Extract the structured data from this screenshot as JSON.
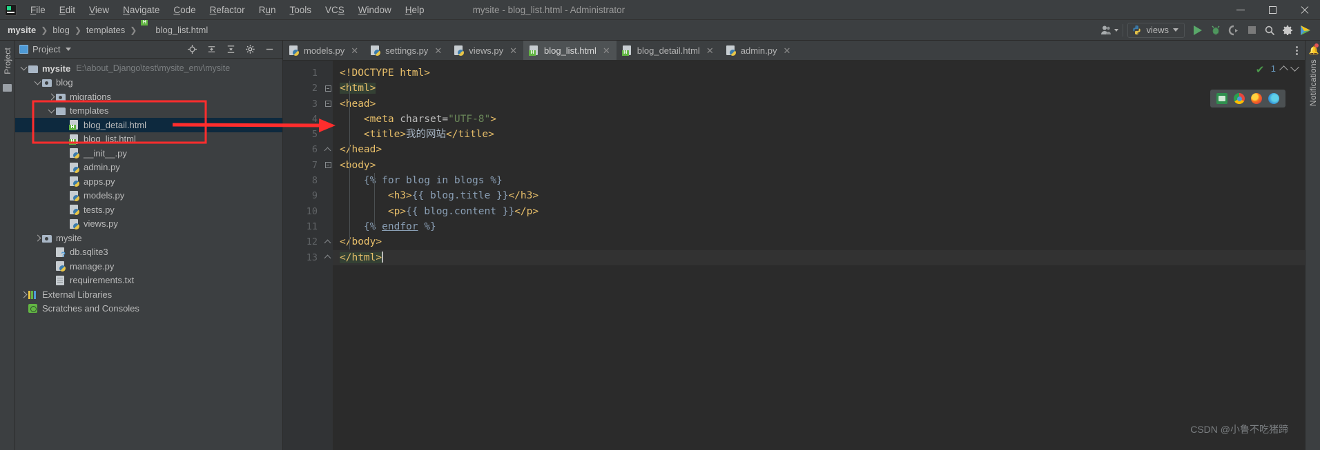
{
  "window": {
    "title": "mysite - blog_list.html - Administrator",
    "app_icon": "pycharm-logo-icon",
    "minimize": "—",
    "maximize": "□",
    "close": "✕"
  },
  "menu": {
    "items": [
      {
        "label": "File",
        "mnemonic": "F"
      },
      {
        "label": "Edit",
        "mnemonic": "E"
      },
      {
        "label": "View",
        "mnemonic": "V"
      },
      {
        "label": "Navigate",
        "mnemonic": "N"
      },
      {
        "label": "Code",
        "mnemonic": "C"
      },
      {
        "label": "Refactor",
        "mnemonic": "R"
      },
      {
        "label": "Run",
        "mnemonic": "u"
      },
      {
        "label": "Tools",
        "mnemonic": "T"
      },
      {
        "label": "VCS",
        "mnemonic": "S"
      },
      {
        "label": "Window",
        "mnemonic": "W"
      },
      {
        "label": "Help",
        "mnemonic": "H"
      }
    ]
  },
  "breadcrumb": {
    "separator": "›",
    "items": [
      {
        "label": "mysite",
        "bold": true,
        "icon": null
      },
      {
        "label": "blog",
        "bold": false,
        "icon": null
      },
      {
        "label": "templates",
        "bold": false,
        "icon": null
      },
      {
        "label": "blog_list.html",
        "bold": false,
        "icon": "html-file-icon"
      }
    ]
  },
  "toolbar": {
    "account_icon": "user-account-icon",
    "run_config": {
      "label": "views",
      "icon": "python-icon",
      "dropdown_icon": "chevron-down-icon"
    },
    "run_icon": "run-play-icon",
    "debug_icon": "debug-bug-icon",
    "coverage_icon": "run-coverage-icon",
    "stop_icon": "stop-square-icon",
    "search_icon": "search-magnifier-icon",
    "settings_icon": "gear-icon",
    "updates_icon": "jetbrains-toolbox-icon"
  },
  "project_panel": {
    "title": "Project",
    "title_icon": "project-view-icon",
    "dropdown_icon": "chevron-down-icon",
    "header_icons": [
      "target-locate-icon",
      "expand-all-icon",
      "collapse-all-icon",
      "gear-icon",
      "hide-panel-icon"
    ],
    "vertical_label": "Project",
    "tree": [
      {
        "label": "mysite",
        "path": "E:\\about_Django\\test\\mysite_env\\mysite",
        "icon": "folder-icon",
        "indent": 0,
        "arrow": "down",
        "bold": true,
        "selected": false
      },
      {
        "label": "blog",
        "path": "",
        "icon": "module-folder-icon",
        "indent": 1,
        "arrow": "down",
        "bold": false,
        "selected": false
      },
      {
        "label": "migrations",
        "path": "",
        "icon": "module-folder-icon",
        "indent": 2,
        "arrow": "right",
        "bold": false,
        "selected": false
      },
      {
        "label": "templates",
        "path": "",
        "icon": "folder-icon",
        "indent": 2,
        "arrow": "down",
        "bold": false,
        "selected": false
      },
      {
        "label": "blog_detail.html",
        "path": "",
        "icon": "html-file-icon",
        "indent": 3,
        "arrow": "none",
        "bold": false,
        "selected": true
      },
      {
        "label": "blog_list.html",
        "path": "",
        "icon": "html-file-icon",
        "indent": 3,
        "arrow": "none",
        "bold": false,
        "selected": false
      },
      {
        "label": "__init__.py",
        "path": "",
        "icon": "python-file-icon",
        "indent": 3,
        "arrow": "none",
        "bold": false,
        "selected": false
      },
      {
        "label": "admin.py",
        "path": "",
        "icon": "python-file-icon",
        "indent": 3,
        "arrow": "none",
        "bold": false,
        "selected": false
      },
      {
        "label": "apps.py",
        "path": "",
        "icon": "python-file-icon",
        "indent": 3,
        "arrow": "none",
        "bold": false,
        "selected": false
      },
      {
        "label": "models.py",
        "path": "",
        "icon": "python-file-icon",
        "indent": 3,
        "arrow": "none",
        "bold": false,
        "selected": false
      },
      {
        "label": "tests.py",
        "path": "",
        "icon": "python-file-icon",
        "indent": 3,
        "arrow": "none",
        "bold": false,
        "selected": false
      },
      {
        "label": "views.py",
        "path": "",
        "icon": "python-file-icon",
        "indent": 3,
        "arrow": "none",
        "bold": false,
        "selected": false
      },
      {
        "label": "mysite",
        "path": "",
        "icon": "module-folder-icon",
        "indent": 1,
        "arrow": "right",
        "bold": false,
        "selected": false
      },
      {
        "label": "db.sqlite3",
        "path": "",
        "icon": "database-file-icon",
        "indent": 2,
        "arrow": "none",
        "bold": false,
        "selected": false
      },
      {
        "label": "manage.py",
        "path": "",
        "icon": "python-file-icon",
        "indent": 2,
        "arrow": "none",
        "bold": false,
        "selected": false
      },
      {
        "label": "requirements.txt",
        "path": "",
        "icon": "text-file-icon",
        "indent": 2,
        "arrow": "none",
        "bold": false,
        "selected": false
      },
      {
        "label": "External Libraries",
        "path": "",
        "icon": "libraries-icon",
        "indent": 0,
        "arrow": "right",
        "bold": false,
        "selected": false
      },
      {
        "label": "Scratches and Consoles",
        "path": "",
        "icon": "scratches-icon",
        "indent": 0,
        "arrow": "none",
        "bold": false,
        "selected": false
      }
    ]
  },
  "editor": {
    "tabs": [
      {
        "label": "models.py",
        "icon": "python-file-icon",
        "active": false,
        "close_icon": "close-icon"
      },
      {
        "label": "settings.py",
        "icon": "python-file-icon",
        "active": false,
        "close_icon": "close-icon"
      },
      {
        "label": "views.py",
        "icon": "python-file-icon",
        "active": false,
        "close_icon": "close-icon"
      },
      {
        "label": "blog_list.html",
        "icon": "html-file-icon",
        "active": true,
        "close_icon": "close-icon"
      },
      {
        "label": "blog_detail.html",
        "icon": "html-file-icon",
        "active": false,
        "close_icon": "close-icon"
      },
      {
        "label": "admin.py",
        "icon": "python-file-icon",
        "active": false,
        "close_icon": "close-icon"
      }
    ],
    "tab_overflow_icon": "more-options-icon",
    "line_numbers": [
      "1",
      "2",
      "3",
      "4",
      "5",
      "6",
      "7",
      "8",
      "9",
      "10",
      "11",
      "12",
      "13"
    ],
    "inspection": {
      "status_icon": "inspection-ok-icon",
      "count": "1",
      "prev_icon": "chevron-up-icon",
      "next_icon": "chevron-down-icon"
    },
    "browser_preview": {
      "icons": [
        "ie-browser-icon",
        "chrome-browser-icon",
        "firefox-browser-icon",
        "edge-browser-icon"
      ]
    }
  },
  "code": {
    "language": "html",
    "lines": [
      {
        "n": 1,
        "indent": 0,
        "fold": "none",
        "parts": [
          {
            "t": "tag",
            "v": "<!DOCTYPE html>"
          }
        ]
      },
      {
        "n": 2,
        "indent": 0,
        "fold": "minus",
        "parts": [
          {
            "t": "hl-tag",
            "v": "<html>"
          }
        ]
      },
      {
        "n": 3,
        "indent": 0,
        "fold": "minus",
        "parts": [
          {
            "t": "tag",
            "v": "<head>"
          }
        ]
      },
      {
        "n": 4,
        "indent": 1,
        "fold": "none",
        "parts": [
          {
            "t": "tag",
            "v": "<meta "
          },
          {
            "t": "attr",
            "v": "charset="
          },
          {
            "t": "attrval",
            "v": "\"UTF-8\""
          },
          {
            "t": "tag",
            "v": ">"
          }
        ]
      },
      {
        "n": 5,
        "indent": 1,
        "fold": "none",
        "parts": [
          {
            "t": "tag",
            "v": "<title>"
          },
          {
            "t": "cn",
            "v": "我的网站"
          },
          {
            "t": "tag",
            "v": "</title>"
          }
        ]
      },
      {
        "n": 6,
        "indent": 0,
        "fold": "up",
        "parts": [
          {
            "t": "tag",
            "v": "</head>"
          }
        ]
      },
      {
        "n": 7,
        "indent": 0,
        "fold": "minus",
        "parts": [
          {
            "t": "tag",
            "v": "<body>"
          }
        ]
      },
      {
        "n": 8,
        "indent": 1,
        "fold": "none",
        "parts": [
          {
            "t": "dj-brace",
            "v": "{% for blog in blogs %}"
          }
        ]
      },
      {
        "n": 9,
        "indent": 2,
        "fold": "none",
        "parts": [
          {
            "t": "tag",
            "v": "<h3>"
          },
          {
            "t": "dj-brace",
            "v": "{{ blog.title }}"
          },
          {
            "t": "tag",
            "v": "</h3>"
          }
        ]
      },
      {
        "n": 10,
        "indent": 2,
        "fold": "none",
        "parts": [
          {
            "t": "tag",
            "v": "<p>"
          },
          {
            "t": "dj-brace",
            "v": "{{ blog.content }}"
          },
          {
            "t": "tag",
            "v": "</p>"
          }
        ]
      },
      {
        "n": 11,
        "indent": 1,
        "fold": "none",
        "parts": [
          {
            "t": "dj-brace",
            "v": "{% "
          },
          {
            "t": "dj-underline",
            "v": "endfor"
          },
          {
            "t": "dj-brace",
            "v": " %}"
          }
        ]
      },
      {
        "n": 12,
        "indent": 0,
        "fold": "up",
        "parts": [
          {
            "t": "tag",
            "v": "</body>"
          }
        ]
      },
      {
        "n": 13,
        "indent": 0,
        "fold": "up",
        "parts": [
          {
            "t": "hl-tag",
            "v": "</html>"
          },
          {
            "t": "caret",
            "v": ""
          }
        ]
      }
    ]
  },
  "annotations": {
    "highlight_rect_label": "red-highlight-rectangle",
    "arrow_label": "red-pointer-arrow",
    "color": "#ff2d2d"
  },
  "notifications": {
    "label": "Notifications",
    "bell_icon": "bell-icon",
    "has_unread": true
  },
  "watermark": {
    "text": "CSDN @小鲁不吃猪蹄"
  }
}
